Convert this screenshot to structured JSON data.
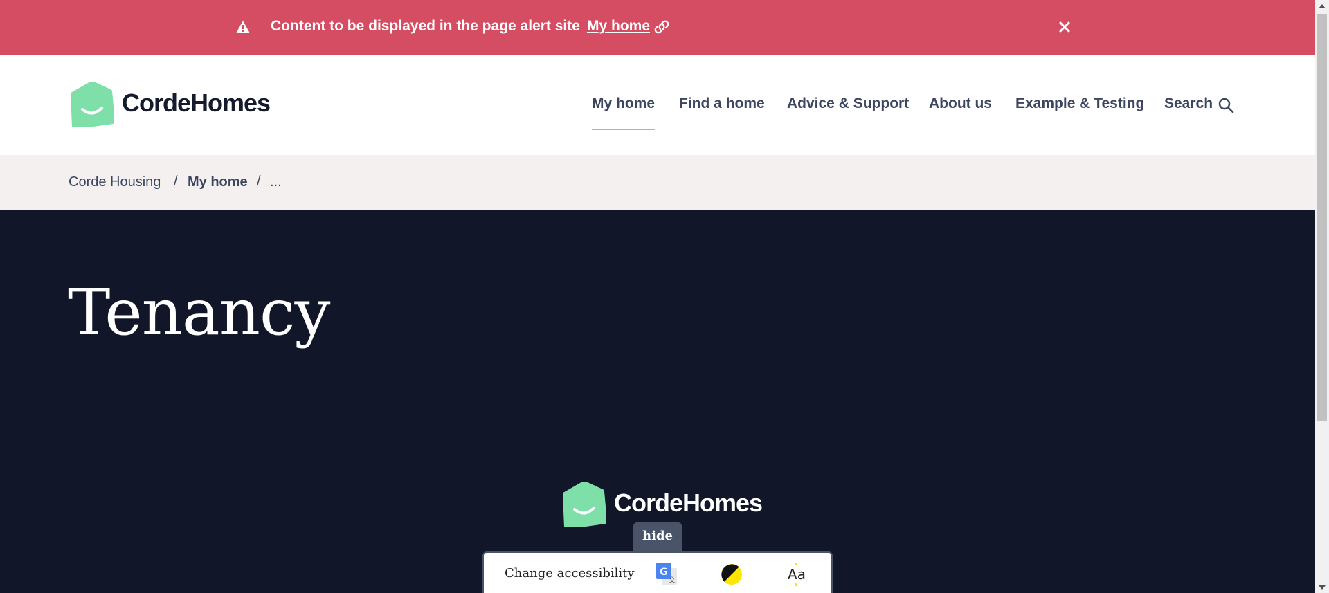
{
  "alert": {
    "message": "Content to be displayed in the page alert site",
    "link_label": "My home",
    "icon": "warning-triangle-icon",
    "link_icon": "link-icon",
    "close_icon": "close-icon",
    "background": "#d44d62"
  },
  "header": {
    "logo_text": "CordeHomes",
    "logo_color": "#7ee0a8",
    "nav": [
      {
        "label": "My home",
        "active": true
      },
      {
        "label": "Find a home",
        "active": false
      },
      {
        "label": "Advice & Support",
        "active": false
      },
      {
        "label": "About us",
        "active": false
      },
      {
        "label": "Example & Testing",
        "active": false
      }
    ],
    "search_label": "Search",
    "search_icon": "search-icon"
  },
  "breadcrumb": {
    "items": [
      "Corde Housing",
      "My home",
      "..."
    ],
    "separator": "/"
  },
  "hero": {
    "title": "Tenancy",
    "background": "#111629"
  },
  "footer": {
    "logo_text": "CordeHomes"
  },
  "accessibility": {
    "hide_label": "hide",
    "label": "Change accessibility",
    "buttons": [
      "translate-icon",
      "contrast-icon",
      "text-size-icon"
    ],
    "text_size_glyph": "Aa"
  }
}
